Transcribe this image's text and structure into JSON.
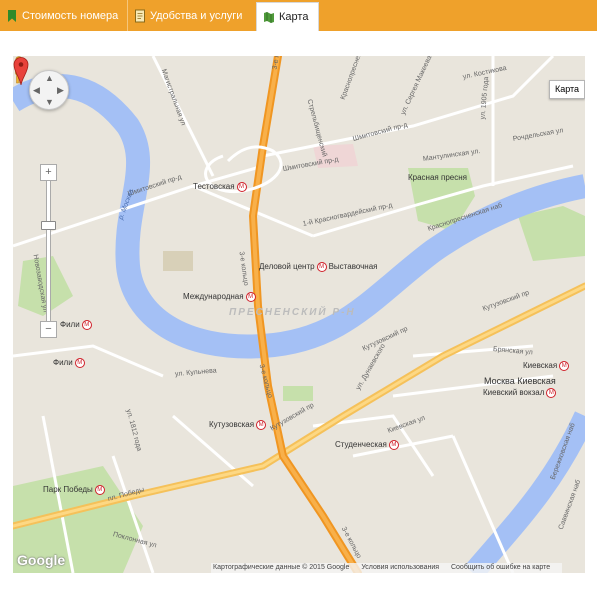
{
  "tabs": [
    {
      "label": "Стоимость номера",
      "icon": "bookmark-icon",
      "active": false
    },
    {
      "label": "Удобства и услуги",
      "icon": "document-icon",
      "active": false
    },
    {
      "label": "Карта",
      "icon": "map-icon",
      "active": true
    }
  ],
  "colors": {
    "tabbar": "#efa12b",
    "river": "#a4c0f5",
    "highway": "#f5a623",
    "land": "#e9e5dc",
    "park": "#c6e0ab"
  },
  "map": {
    "type_button": "Карта",
    "district": "ПРЕСНЕНСКИЙ Р-Н",
    "stations": [
      "Тестовская",
      "Деловой центр",
      "Выставочная",
      "Международная",
      "Фили",
      "Фили",
      "Кутузовская",
      "Студенческая",
      "Киевская",
      "Киевская",
      "Парк Победы",
      "Красная пресня"
    ],
    "places": [
      "Москва Киевская",
      "Киевский вокзал"
    ],
    "streets": [
      "Шмитовский пр-д",
      "Шмитовский пр-д",
      "Шмитовский пр-д",
      "1-й Красногвардейский пр-д",
      "Мантулинская ул.",
      "Краснопресненская наб",
      "Кутузовский пр",
      "Кутузовский пр",
      "Кутузовский пр",
      "пл. Победы",
      "3-е кольцо",
      "3-е кольцо",
      "3-е кольцо",
      "3-е кольцо",
      "р. Москва",
      "ул. Кульнева",
      "ул. 1812 года",
      "ул. 1905 года",
      "ул. Костикова",
      "Рочдельская ул",
      "Киевская ул",
      "Брянская ул",
      "ул. Дунаевского",
      "Поклонная ул",
      "Бережковская наб",
      "Саввинская наб",
      "Магистральная ул",
      "Новозаводская ул",
      "Стрельбищенский",
      "Краснопресненская ул",
      "ул. Сергея Макеева"
    ],
    "google_logo": "Google",
    "attribution": [
      "Картографические данные © 2015 Google",
      "Условия использования",
      "Сообщить об ошибке на карте"
    ]
  }
}
